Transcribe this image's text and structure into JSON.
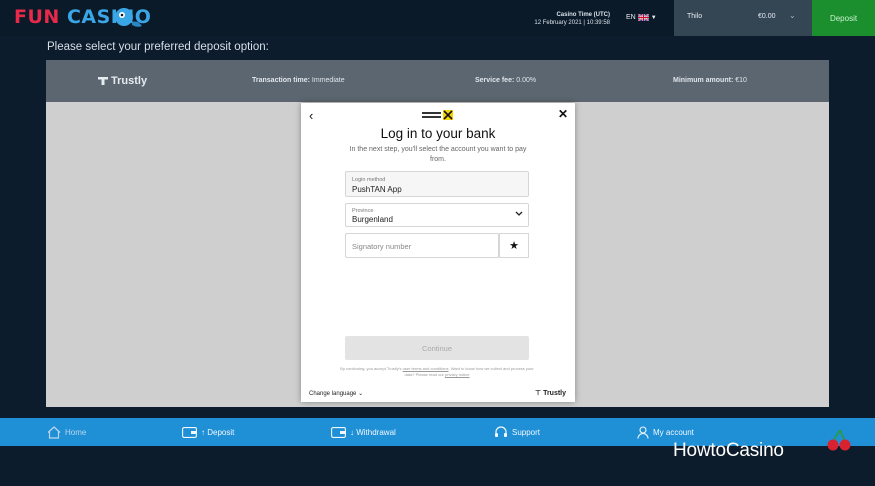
{
  "header": {
    "logo_fun": "FUN",
    "logo_casino": "CASINO",
    "casino_time_label": "Casino Time (UTC)",
    "casino_time_value": "12 February 2021 | 10:39:58",
    "language": "EN",
    "username": "Thilo",
    "balance": "€0.00",
    "deposit_label": "Deposit"
  },
  "prompt": "Please select your preferred deposit option:",
  "provider_bar": {
    "name": "Trustly",
    "transaction_label": "Transaction time:",
    "transaction_value": "Immediate",
    "fee_label": "Service fee:",
    "fee_value": "0.00%",
    "min_label": "Minimum amount:",
    "min_value": "€10"
  },
  "modal": {
    "title": "Log in to your bank",
    "subtitle": "In the next step, you'll select the account you want to pay from.",
    "login_method_label": "Login method",
    "login_method_value": "PushTAN App",
    "province_label": "Province",
    "province_value": "Burgenland",
    "signatory_placeholder": "Signatory number",
    "continue_label": "Continue",
    "legal_pre": "By continuing, you accept Trustly's",
    "legal_link1": "user terms and conditions",
    "legal_mid": ". Want to know how we collect and process your data? Please read our",
    "legal_link2": "privacy notice",
    "change_language": "Change language",
    "trustly": "Trustly"
  },
  "nav": [
    {
      "label": "Home"
    },
    {
      "label": "↑ Deposit"
    },
    {
      "label": "↓ Withdrawal"
    },
    {
      "label": "Support"
    },
    {
      "label": "My account"
    }
  ],
  "watermark": "HowtoCasino",
  "colors": {
    "accent_blue": "#1f8fd6",
    "deposit_green": "#1b8e2e",
    "logo_red": "#e8294a"
  }
}
